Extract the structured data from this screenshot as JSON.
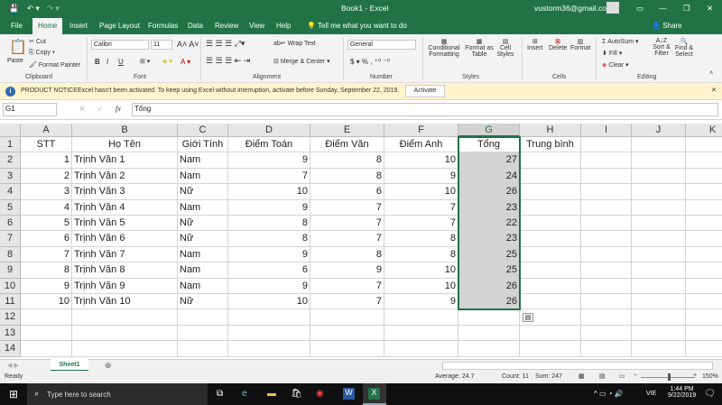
{
  "title": {
    "doc": "Book1 - Excel",
    "user": "vustorm36@gmail.com"
  },
  "tabs": [
    "File",
    "Home",
    "Insert",
    "Page Layout",
    "Formulas",
    "Data",
    "Review",
    "View",
    "Help"
  ],
  "tell_me": "Tell me what you want to do",
  "share": "Share",
  "ribbon": {
    "clipboard": {
      "paste": "Paste",
      "cut": "Cut",
      "copy": "Copy",
      "format_painter": "Format Painter",
      "label": "Clipboard"
    },
    "font": {
      "name": "Calibri",
      "size": "11",
      "bold": "B",
      "italic": "I",
      "underline": "U",
      "label": "Font"
    },
    "alignment": {
      "wrap": "Wrap Text",
      "merge": "Merge & Center",
      "label": "Alignment"
    },
    "number": {
      "format": "General",
      "dollar": "$",
      "percent": "%",
      "comma": ",",
      "label": "Number"
    },
    "styles": {
      "cond": "Conditional Formatting",
      "table": "Format as Table",
      "cell": "Cell Styles",
      "label": "Styles"
    },
    "cells": {
      "insert": "Insert",
      "delete": "Delete",
      "format": "Format",
      "label": "Cells"
    },
    "editing": {
      "autosum": "AutoSum",
      "fill": "Fill",
      "clear": "Clear",
      "sort": "Sort & Filter",
      "find": "Find & Select",
      "label": "Editing"
    }
  },
  "notice": {
    "title": "PRODUCT NOTICE",
    "text": "Excel hasn't been activated. To keep using Excel without interruption, activate before Sunday, September 22, 2019.",
    "button": "Activate"
  },
  "formula_bar": {
    "name_box": "G1",
    "fx": "fx",
    "value": "Tổng"
  },
  "columns": [
    "A",
    "B",
    "C",
    "D",
    "E",
    "F",
    "G",
    "H",
    "I",
    "J",
    "K"
  ],
  "rows": [
    [
      "STT",
      "Họ Tên",
      "Giới Tính",
      "Điểm Toán",
      "Điểm Văn",
      "Điểm Anh",
      "Tổng",
      "Trung bình"
    ],
    [
      "1",
      "Trịnh Văn 1",
      "Nam",
      "9",
      "8",
      "10",
      "27",
      ""
    ],
    [
      "2",
      "Trịnh Văn 2",
      "Nam",
      "7",
      "8",
      "9",
      "24",
      ""
    ],
    [
      "3",
      "Trịnh Văn 3",
      "Nữ",
      "10",
      "6",
      "10",
      "26",
      ""
    ],
    [
      "4",
      "Trịnh Văn 4",
      "Nam",
      "9",
      "7",
      "7",
      "23",
      ""
    ],
    [
      "5",
      "Trịnh Văn 5",
      "Nữ",
      "8",
      "7",
      "7",
      "22",
      ""
    ],
    [
      "6",
      "Trịnh Văn 6",
      "Nữ",
      "8",
      "7",
      "8",
      "23",
      ""
    ],
    [
      "7",
      "Trịnh Văn 7",
      "Nam",
      "9",
      "8",
      "8",
      "25",
      ""
    ],
    [
      "8",
      "Trịnh Văn 8",
      "Nam",
      "6",
      "9",
      "10",
      "25",
      ""
    ],
    [
      "9",
      "Trịnh Văn 9",
      "Nam",
      "9",
      "7",
      "10",
      "26",
      ""
    ],
    [
      "10",
      "Trịnh Văn 10",
      "Nữ",
      "10",
      "7",
      "9",
      "26",
      ""
    ],
    [
      "",
      "",
      "",
      "",
      "",
      "",
      "",
      ""
    ],
    [
      "",
      "",
      "",
      "",
      "",
      "",
      "",
      ""
    ],
    [
      "",
      "",
      "",
      "",
      "",
      "",
      "",
      ""
    ]
  ],
  "sheet_tab": "Sheet1",
  "status": {
    "ready": "Ready",
    "average": "Average: 24.7",
    "count": "Count: 11",
    "sum": "Sum: 247",
    "zoom": "150%"
  },
  "taskbar": {
    "search": "Type here to search",
    "lang": "VIE",
    "time": "1:44 PM",
    "date": "9/22/2019"
  }
}
